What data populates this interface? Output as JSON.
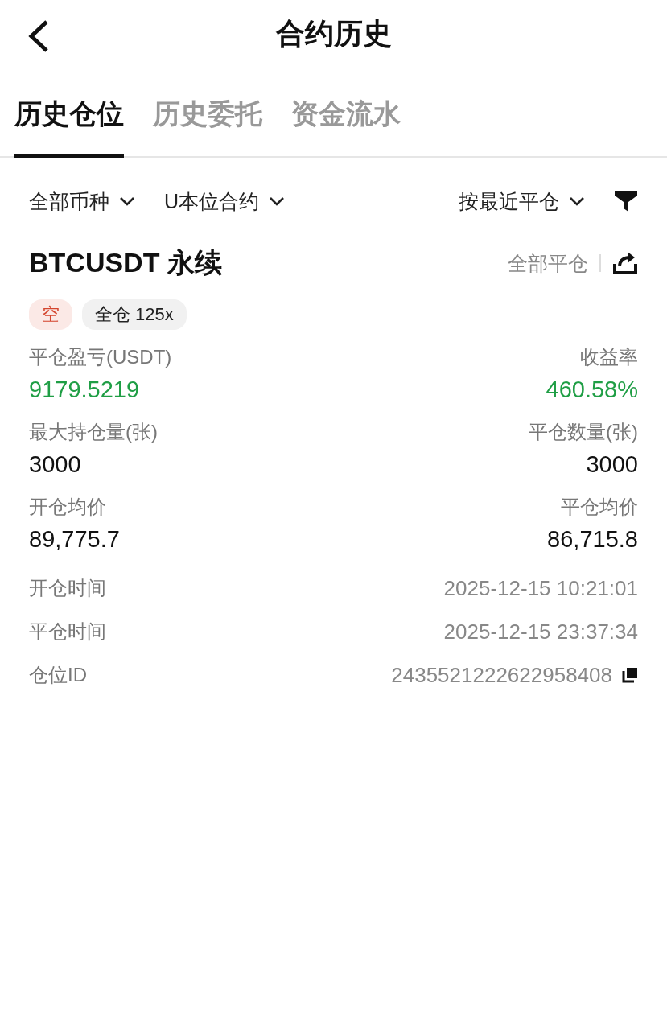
{
  "header": {
    "title": "合约历史"
  },
  "tabs": [
    {
      "label": "历史仓位",
      "selected": true
    },
    {
      "label": "历史委托",
      "selected": false
    },
    {
      "label": "资金流水",
      "selected": false
    }
  ],
  "filters": {
    "left": [
      "全部币种",
      "U本位合约"
    ],
    "sort": "按最近平仓"
  },
  "position": {
    "symbol": "BTCUSDT 永续",
    "close_all": "全部平仓",
    "tags": [
      {
        "label": "空",
        "kind": "short"
      },
      {
        "label": "全仓 125x",
        "kind": "plain"
      }
    ],
    "stats": [
      {
        "label": "平仓盈亏(USDT)",
        "value": "9179.5219",
        "kind": "gain"
      },
      {
        "label": "收益率",
        "value": "460.58%",
        "kind": "gain"
      },
      {
        "label": "最大持仓量(张)",
        "value": "3000",
        "kind": "plain"
      },
      {
        "label": "平仓数量(张)",
        "value": "3000",
        "kind": "plain"
      },
      {
        "label": "开仓均价",
        "value": "89,775.7",
        "kind": "plain"
      },
      {
        "label": "平仓均价",
        "value": "86,715.8",
        "kind": "plain"
      }
    ],
    "details": [
      {
        "label": "开仓时间",
        "value": "2025-12-15 10:21:01",
        "copyable": false
      },
      {
        "label": "平仓时间",
        "value": "2025-12-15 23:37:34",
        "copyable": false
      },
      {
        "label": "仓位ID",
        "value": "2435521222622958408",
        "copyable": true
      }
    ]
  }
}
